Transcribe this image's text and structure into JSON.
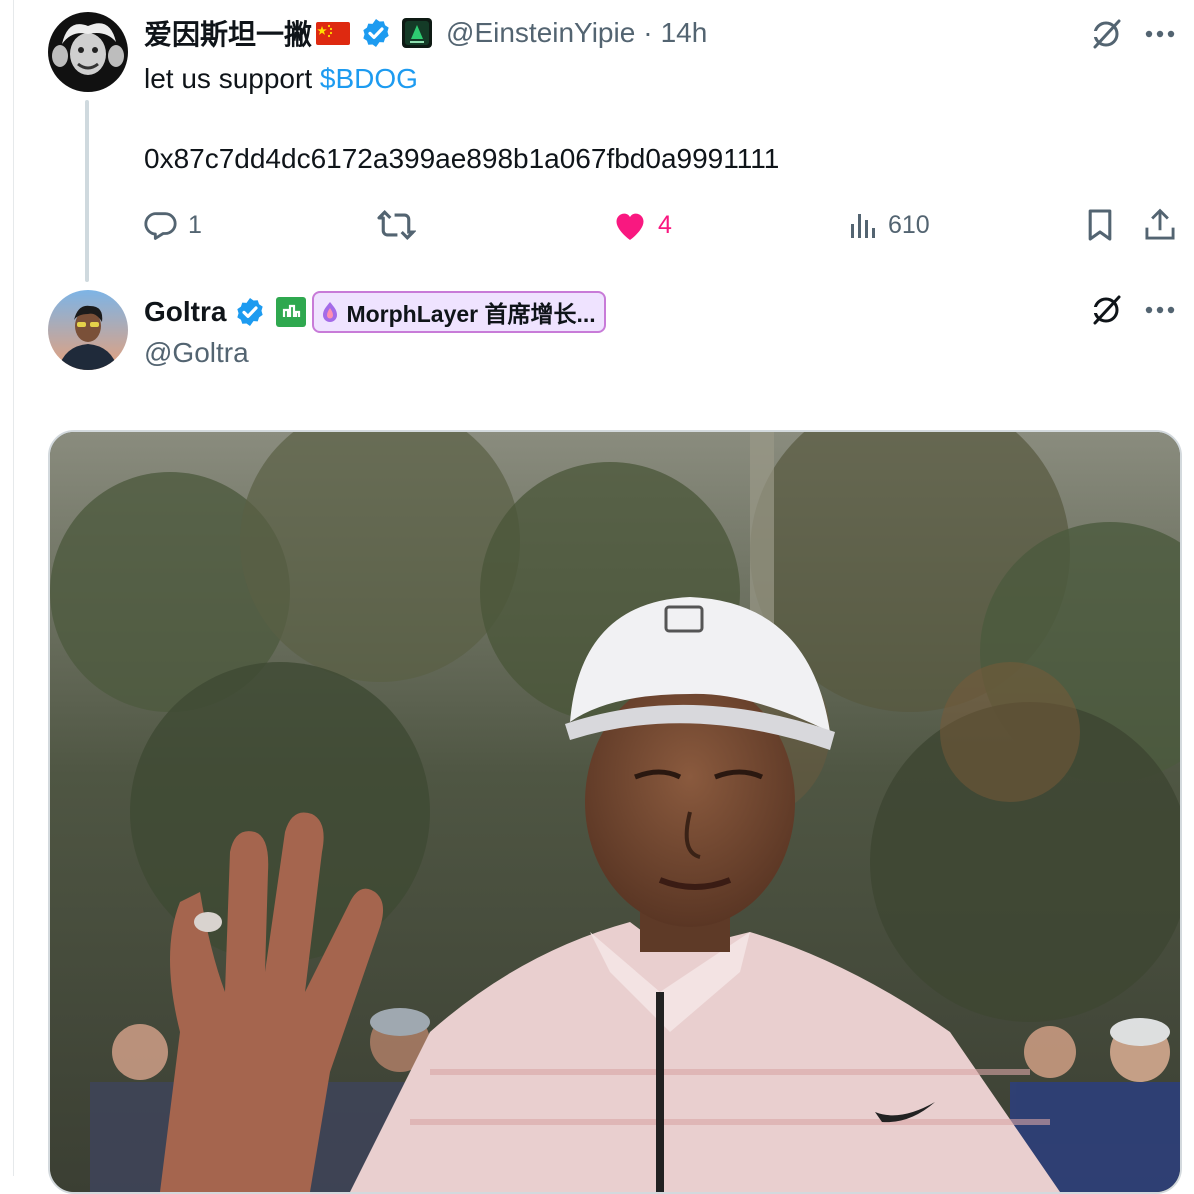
{
  "tweet1": {
    "display_name": "爱因斯坦一撇",
    "handle": "@EinsteinYipie",
    "separator": "·",
    "time": "14h",
    "text_lead": "let us support ",
    "cashtag": "$BDOG",
    "address": "0x87c7dd4dc6172a399ae898b1a067fbd0a9991111",
    "replies": "1",
    "likes": "4",
    "views": "610",
    "flag_icon": "china-flag-icon",
    "badge_icon": "verified-badge-icon",
    "affiliate_icon": "green-logo-badge-icon"
  },
  "tweet2": {
    "display_name": "Goltra",
    "handle": "@Goltra",
    "affiliation": "MorphLayer 首席增长...",
    "badge_icon": "verified-badge-icon",
    "media_alt_icon": "photo-golfer-waving"
  },
  "colors": {
    "accent": "#1d9bf0",
    "like": "#f91880",
    "secondary_text": "#536471",
    "affiliation_bg": "#efe3ff",
    "affiliation_border": "#c87bd8"
  }
}
